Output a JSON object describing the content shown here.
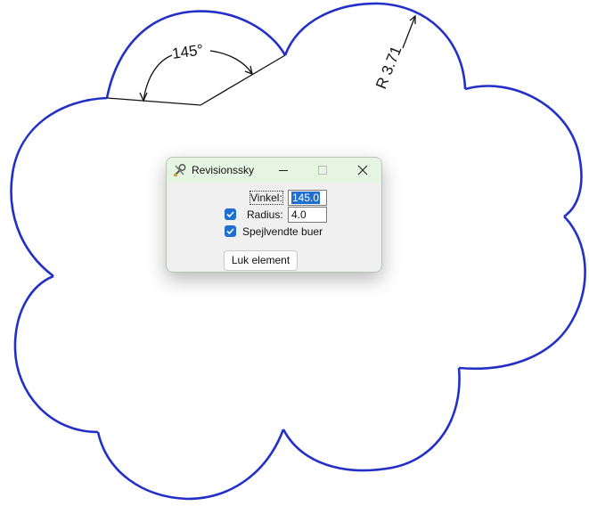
{
  "drawing": {
    "cloud_color": "#2330c8",
    "angle_label": "145°",
    "radius_label": "R 3.71"
  },
  "dialog": {
    "title": "Revisionssky",
    "minimize_icon": "minimize-icon",
    "maximize_icon": "maximize-icon",
    "close_icon": "close-icon",
    "vinkel_label": "Vinkel:",
    "vinkel_value": "145.0",
    "radius_label": "Radius:",
    "radius_value": "4.0",
    "radius_checked": true,
    "spejl_label": "Spejlvendte buer",
    "spejl_checked": true,
    "close_button": "Luk element",
    "accent": "#1f6fd1",
    "titlebar_color": "#e6f5e2"
  }
}
